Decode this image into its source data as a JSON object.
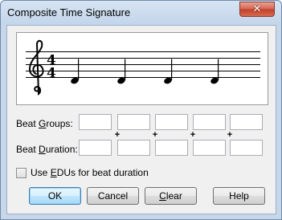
{
  "window": {
    "title": "Composite Time Signature",
    "close_glyph": "✕"
  },
  "time_signature": {
    "numerator": "4",
    "denominator": "4",
    "note_count": 4
  },
  "beat_groups": {
    "label_pre": "Beat ",
    "label_ul": "G",
    "label_post": "roups:",
    "values": [
      "",
      "",
      "",
      "",
      ""
    ]
  },
  "beat_duration": {
    "label_pre": "Beat ",
    "label_ul": "D",
    "label_post": "uration:",
    "values": [
      "",
      "",
      "",
      "",
      ""
    ]
  },
  "plus_sign": "+",
  "edu_option": {
    "label_pre": "Use ",
    "label_ul": "E",
    "label_post": "DUs for beat duration",
    "checked": false
  },
  "buttons": {
    "ok": "OK",
    "cancel": "Cancel",
    "clear_ul": "C",
    "clear_rest": "lear",
    "help": "Help"
  }
}
